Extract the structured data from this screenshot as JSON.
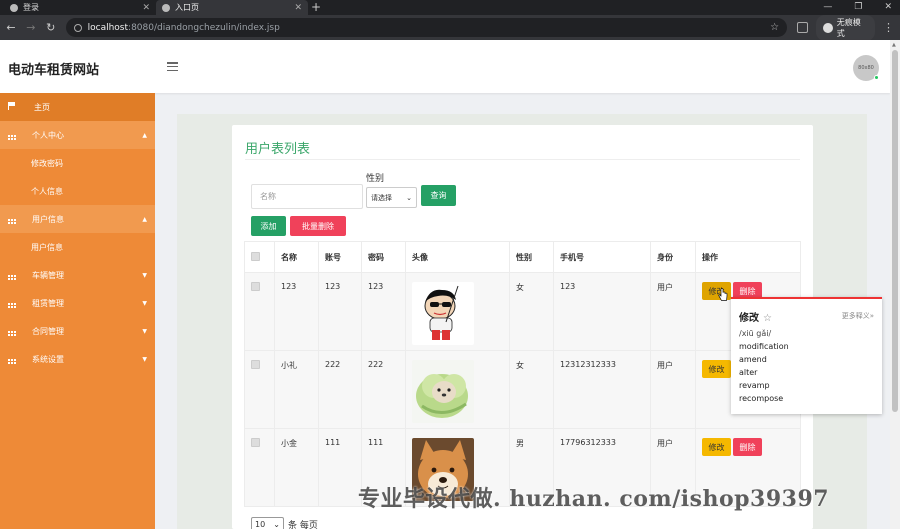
{
  "browser": {
    "tabs": [
      {
        "label": "登录",
        "active": false
      },
      {
        "label": "入口页",
        "active": true
      }
    ],
    "url_host": "localhost",
    "url_path": ":8080/diandongchezulin/index.jsp",
    "incognito_label": "无痕模式"
  },
  "header": {
    "site_title": "电动车租赁网站",
    "avatar_text": "80x80"
  },
  "sidebar": {
    "items": [
      {
        "label": "主页",
        "icon": "flag-icon",
        "type": "home"
      },
      {
        "label": "个人中心",
        "icon": "grid-icon",
        "type": "parent",
        "expanded": true,
        "children": [
          "修改密码",
          "个人信息"
        ]
      },
      {
        "label": "用户信息",
        "icon": "grid-icon",
        "type": "parent",
        "expanded": true,
        "children": [
          "用户信息"
        ]
      },
      {
        "label": "车辆管理",
        "icon": "grid-icon",
        "type": "collapsed"
      },
      {
        "label": "租赁管理",
        "icon": "grid-icon",
        "type": "collapsed"
      },
      {
        "label": "合同管理",
        "icon": "grid-icon",
        "type": "collapsed"
      },
      {
        "label": "系统设置",
        "icon": "grid-icon",
        "type": "collapsed"
      }
    ]
  },
  "main": {
    "title": "用户表列表",
    "search": {
      "name_placeholder": "名称",
      "gender_label": "性别",
      "gender_selected": "请选择",
      "query_label": "查询"
    },
    "actions": {
      "add_label": "添加",
      "batch_delete_label": "批量删除"
    },
    "table": {
      "headers": [
        "名称",
        "账号",
        "密码",
        "头像",
        "性别",
        "手机号",
        "身份",
        "操作"
      ],
      "rows": [
        {
          "name": "123",
          "account": "123",
          "password": "123",
          "avatar": "cartoon-boy-image",
          "gender": "女",
          "phone": "123",
          "role": "用户",
          "edit": "修改",
          "delete": "删除"
        },
        {
          "name": "小礼",
          "account": "222",
          "password": "222",
          "avatar": "cabbage-dog-image",
          "gender": "女",
          "phone": "12312312333",
          "role": "用户",
          "edit": "修改",
          "delete": "删除"
        },
        {
          "name": "小金",
          "account": "111",
          "password": "111",
          "avatar": "shiba-dog-image",
          "gender": "男",
          "phone": "17796312333",
          "role": "用户",
          "edit": "修改",
          "delete": "删除"
        }
      ]
    },
    "pager": {
      "page_size": "10",
      "suffix": "条 每页"
    }
  },
  "dictionary_popup": {
    "word": "修改",
    "star": "☆",
    "more": "更多释义»",
    "pinyin": "/xiū gǎi/",
    "definitions": [
      "modification",
      "amend",
      "alter",
      "revamp",
      "recompose"
    ]
  },
  "watermark": "专业毕设代做. huzhan. com/ishop39397",
  "colors": {
    "sidebar": "#ee8a37",
    "accent_green": "#25a065",
    "danger": "#f0415a",
    "warning": "#f5b800"
  }
}
